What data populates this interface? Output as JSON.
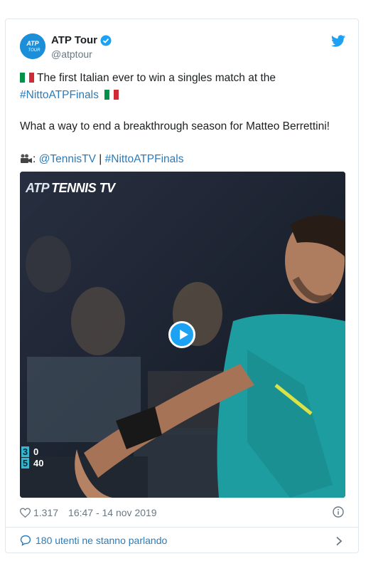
{
  "tweet": {
    "author_name": "ATP Tour",
    "author_handle": "@atptour",
    "avatar_logo": "ATP TOUR",
    "line1": "The first Italian ever to win a singles match at the",
    "hashtag1": "#NittoATPFinals",
    "line2": "What a way to end a breakthrough season for Matteo Berrettini!",
    "credit_sep": ":",
    "credit_mention": "@TennisTV",
    "credit_pipe": " | ",
    "credit_hashtag": "#NittoATPFinals",
    "icons": {
      "verified": "verified-badge-icon",
      "bird": "twitter-bird-icon",
      "flag": "italy-flag-icon",
      "camera": "movie-camera-icon"
    }
  },
  "media": {
    "overlay_logo_atp": "ATP",
    "overlay_logo_tv": "TENNIS TV",
    "score": [
      {
        "set": "3",
        "game": "0"
      },
      {
        "set": "5",
        "game": "40"
      }
    ],
    "colors": {
      "background": "#1a2230",
      "shirt": "#1fa6a8",
      "score_accent": "#36b7d0"
    }
  },
  "meta": {
    "likes": "1.317",
    "timestamp": "16:47 - 14 nov 2019"
  },
  "footer": {
    "conversation": "180 utenti ne stanno parlando"
  },
  "colors": {
    "link": "#2b7bb9",
    "brand": "#1da1f2",
    "muted": "#697882",
    "border": "#e1e8ed"
  }
}
